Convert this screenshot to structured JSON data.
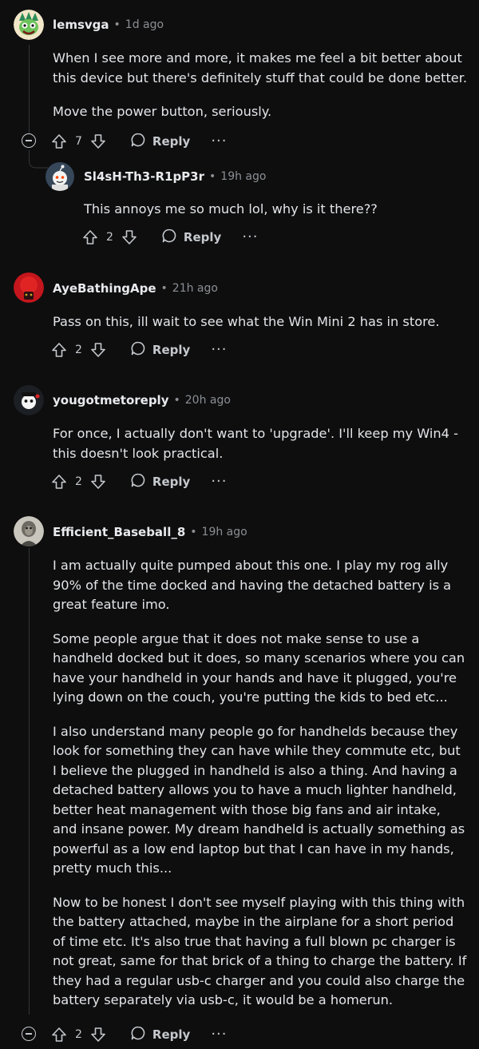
{
  "comments": [
    {
      "username": "lemsvga",
      "time": "1d ago",
      "paragraphs": [
        "When I see more and more, it makes me feel a bit better about this device but there's definitely stuff that could be done better.",
        "Move the power button, seriously."
      ],
      "votes": "7",
      "reply_label": "Reply",
      "more_label": "···"
    },
    {
      "username": "Sl4sH-Th3-R1pP3r",
      "time": "19h ago",
      "paragraphs": [
        "This annoys me so much lol, why is it there??"
      ],
      "votes": "2",
      "reply_label": "Reply",
      "more_label": "···"
    },
    {
      "username": "AyeBathingApe",
      "time": "21h ago",
      "paragraphs": [
        "Pass on this, ill wait to see what the Win Mini 2 has in store."
      ],
      "votes": "2",
      "reply_label": "Reply",
      "more_label": "···"
    },
    {
      "username": "yougotmetoreply",
      "time": "20h ago",
      "paragraphs": [
        "For once, I actually don't want to 'upgrade'. I'll keep my Win4 - this doesn't look practical."
      ],
      "votes": "2",
      "reply_label": "Reply",
      "more_label": "···"
    },
    {
      "username": "Efficient_Baseball_8",
      "time": "19h ago",
      "paragraphs": [
        "I am actually quite pumped about this one. I play my rog ally 90% of the time docked and having the detached battery is a great feature imo.",
        "Some people argue that it does not make sense to use a handheld docked but it does, so many scenarios where you can have your handheld in your hands and have it plugged, you're lying down on the couch, you're putting the kids to bed etc...",
        "I also understand many people go for handhelds because they look for something they can have while they commute etc, but I believe the plugged in handheld is also a thing. And having a detached battery allows you to have a much lighter handheld, better heat management with those big fans and air intake, and insane power. My dream handheld is actually something as powerful as a low end laptop but that I can have in my hands, pretty much this...",
        "Now to be honest I don't see myself playing with this thing with the battery attached, maybe in the airplane for a short period of time etc. It's also true that having a full blown pc charger is not great, same for that brick of a thing to charge the battery. If they had a regular usb-c charger and you could also charge the battery separately via usb-c, it would be a homerun."
      ],
      "votes": "2",
      "reply_label": "Reply",
      "more_label": "···"
    }
  ],
  "separator": "•"
}
